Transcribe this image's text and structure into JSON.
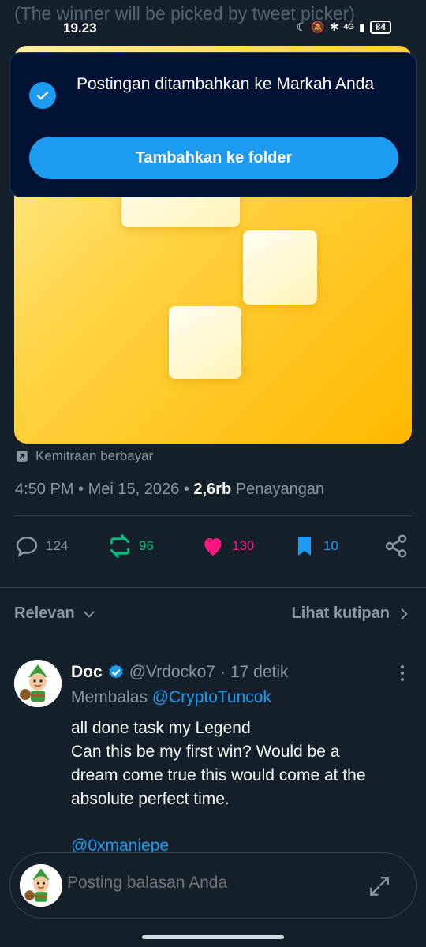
{
  "background_tweet": {
    "ghost_text": "(The winner will be picked by tweet picker)"
  },
  "statusbar": {
    "time": "19.23",
    "network": "4G",
    "battery": "84"
  },
  "toast": {
    "message": "Postingan ditambahkan ke Markah Anda",
    "button_label": "Tambahkan ke folder"
  },
  "tweet": {
    "paid_label": "Kemitraan berbayar",
    "time": "4:50 PM",
    "date": "Mei 15, 2026",
    "views_count": "2,6rb",
    "views_label": "Penayangan",
    "stats": {
      "replies": "124",
      "reposts": "96",
      "likes": "130",
      "bookmarks": "10"
    }
  },
  "sort": {
    "relevance_label": "Relevan",
    "quotes_label": "Lihat kutipan"
  },
  "reply": {
    "name": "Doc",
    "handle": "@Vrdocko7",
    "time": "17 detik",
    "replying_prefix": "Membalas",
    "replying_to": "@CryptoTuncok",
    "lines": [
      "all done task my Legend",
      "Can this be my first win? Would be a",
      "dream come true this would come at the",
      "absolute perfect time."
    ],
    "mention": "@0xmaniepe"
  },
  "composer": {
    "placeholder": "Posting balasan Anda"
  },
  "colors": {
    "accent": "#1d9bf0",
    "repost": "#00ba7c",
    "like": "#f91880",
    "background": "#15202b"
  }
}
